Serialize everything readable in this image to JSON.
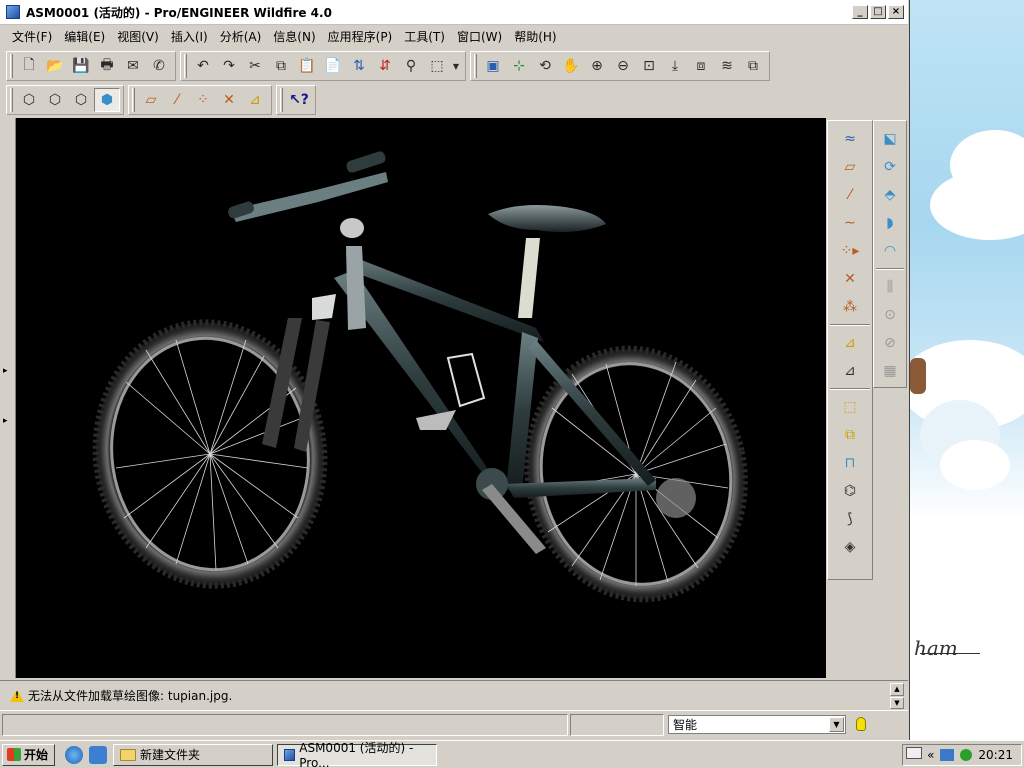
{
  "window": {
    "title": "ASM0001 (活动的) - Pro/ENGINEER Wildfire 4.0",
    "minimize": "_",
    "maximize": "□",
    "close": "×"
  },
  "menu": [
    "文件(F)",
    "编辑(E)",
    "视图(V)",
    "插入(I)",
    "分析(A)",
    "信息(N)",
    "应用程序(P)",
    "工具(T)",
    "窗口(W)",
    "帮助(H)"
  ],
  "toolbar1": {
    "file": [
      "new-icon",
      "open-icon",
      "save-icon",
      "print-icon",
      "send-icon",
      "email-icon"
    ],
    "edit": [
      "undo-icon",
      "redo-icon",
      "cut-icon",
      "copy-icon",
      "paste-icon",
      "paste-special-icon",
      "regenerate-icon",
      "regenerate-manager-icon",
      "find-icon",
      "select-box-icon"
    ],
    "view": [
      "repaint-icon",
      "spin-center-icon",
      "orient-icon",
      "pan-icon",
      "zoom-in-icon",
      "zoom-out-icon",
      "refit-icon",
      "reorient-icon",
      "view-manager-icon",
      "layers-icon",
      "appearance-icon"
    ]
  },
  "toolbar2": {
    "display": [
      "wireframe-icon",
      "hidden-line-icon",
      "no-hidden-icon",
      "shading-icon"
    ],
    "datum": [
      "datum-plane-display-icon",
      "datum-axis-display-icon",
      "datum-point-display-icon",
      "csys-display-icon",
      "annotation-display-icon"
    ],
    "help": "context-help-icon"
  },
  "side_toolbar_left": [
    "sketch-tool-icon",
    "datum-plane-icon",
    "datum-axis-icon",
    "datum-curve-icon",
    "datum-point-icon",
    "csys-icon",
    "analysis-feature-icon",
    "annotation-icon",
    "annotation-edit-icon",
    "insert-component-icon",
    "create-component-icon",
    "mirror-part-icon",
    "offset-icon",
    "skeleton-icon",
    "cut-feature-icon"
  ],
  "side_toolbar_right": [
    "hole-icon",
    "revolve-icon",
    "extrude-icon",
    "sweep-icon",
    "round-icon",
    "pattern-icon",
    "merge-icon",
    "trim-icon",
    "intersect-icon",
    "array-icon"
  ],
  "message": "无法从文件加载草绘图像: tupian.jpg.",
  "filter": {
    "value": "智能"
  },
  "taskbar": {
    "start": "开始",
    "tasks": [
      {
        "label": "新建文件夹"
      },
      {
        "label": "ASM0001 (活动的) - Pro..."
      }
    ],
    "clock": "20:21",
    "tray_chevron": "«"
  },
  "desktop": {
    "text": "ham"
  },
  "colors": {
    "viewport_bg": "#000000",
    "chrome": "#d4d0c8",
    "frame": "#2a3a3c"
  }
}
